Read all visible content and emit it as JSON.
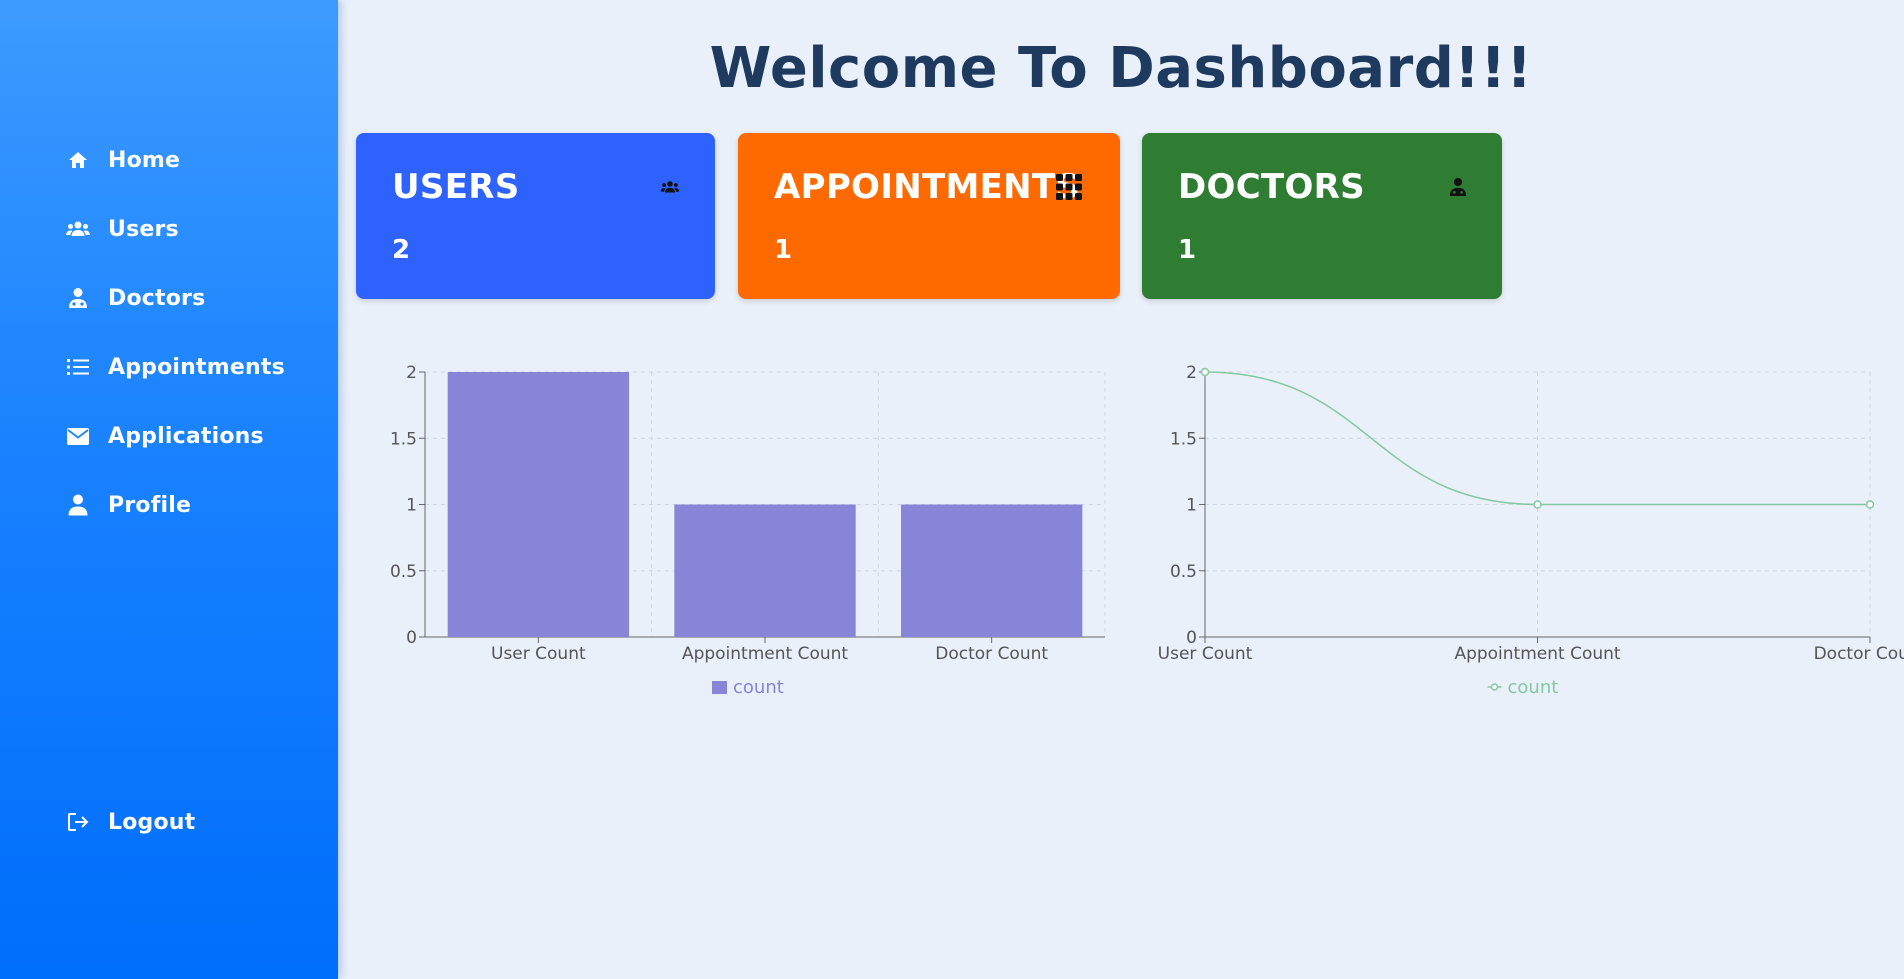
{
  "sidebar": {
    "items": [
      {
        "label": "Home",
        "icon": "home-icon"
      },
      {
        "label": "Users",
        "icon": "users-icon"
      },
      {
        "label": "Doctors",
        "icon": "doctor-icon"
      },
      {
        "label": "Appointments",
        "icon": "list-icon"
      },
      {
        "label": "Applications",
        "icon": "envelope-icon"
      },
      {
        "label": "Profile",
        "icon": "user-icon"
      }
    ],
    "logout": {
      "label": "Logout",
      "icon": "logout-icon"
    }
  },
  "main": {
    "title": "Welcome To Dashboard!!!",
    "cards": [
      {
        "title": "USERS",
        "value": "2",
        "icon": "users-icon",
        "color": "#2d62ff"
      },
      {
        "title": "APPOINTMENTS",
        "value": "1",
        "icon": "grid-icon",
        "color": "#ff6a00"
      },
      {
        "title": "DOCTORS",
        "value": "1",
        "icon": "doctor-icon",
        "color": "#2e7d32"
      }
    ]
  },
  "colors": {
    "bar": "#8884d8",
    "line": "#82ca9d",
    "title": "#1e3a5f"
  },
  "chart_data": [
    {
      "type": "bar",
      "categories": [
        "User Count",
        "Appointment Count",
        "Doctor Count"
      ],
      "series": [
        {
          "name": "count",
          "values": [
            2,
            1,
            1
          ]
        }
      ],
      "yticks": [
        "0",
        "0.5",
        "1",
        "1.5",
        "2"
      ],
      "ylim": [
        0,
        2
      ],
      "grid": true,
      "legend": "bottom-center"
    },
    {
      "type": "line",
      "categories": [
        "User Count",
        "Appointment Count",
        "Doctor Count"
      ],
      "series": [
        {
          "name": "count",
          "values": [
            2,
            1,
            1
          ]
        }
      ],
      "yticks": [
        "0",
        "0.5",
        "1",
        "1.5",
        "2"
      ],
      "ylim": [
        0,
        2
      ],
      "grid": true,
      "legend": "bottom-center"
    }
  ]
}
